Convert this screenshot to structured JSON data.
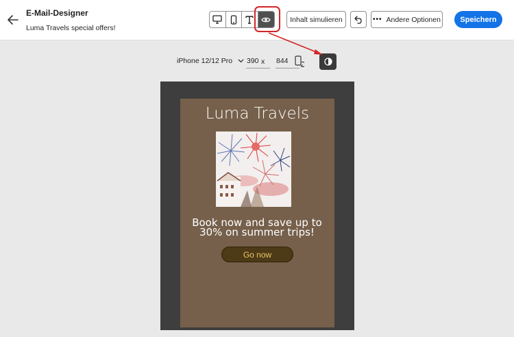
{
  "header": {
    "title": "E-Mail-Designer",
    "subtitle": "Luma Travels special offers!",
    "simulate_label": "Inhalt simulieren",
    "more_label": "Andere Optionen",
    "save_label": "Speichern"
  },
  "view_modes": [
    "desktop-icon",
    "mobile-icon",
    "text-icon",
    "eye-icon"
  ],
  "device": {
    "name": "iPhone 12/12 Pro",
    "width": "390",
    "separator": "x",
    "height": "844"
  },
  "email": {
    "title": "Luma Travels",
    "body_text": "Book now and save up to 30% on summer trips!",
    "cta_label": "Go now"
  },
  "colors": {
    "accent": "#1473e6",
    "highlight": "#d42426",
    "email_background": "#76604b",
    "cta_text": "#e8c56a"
  }
}
